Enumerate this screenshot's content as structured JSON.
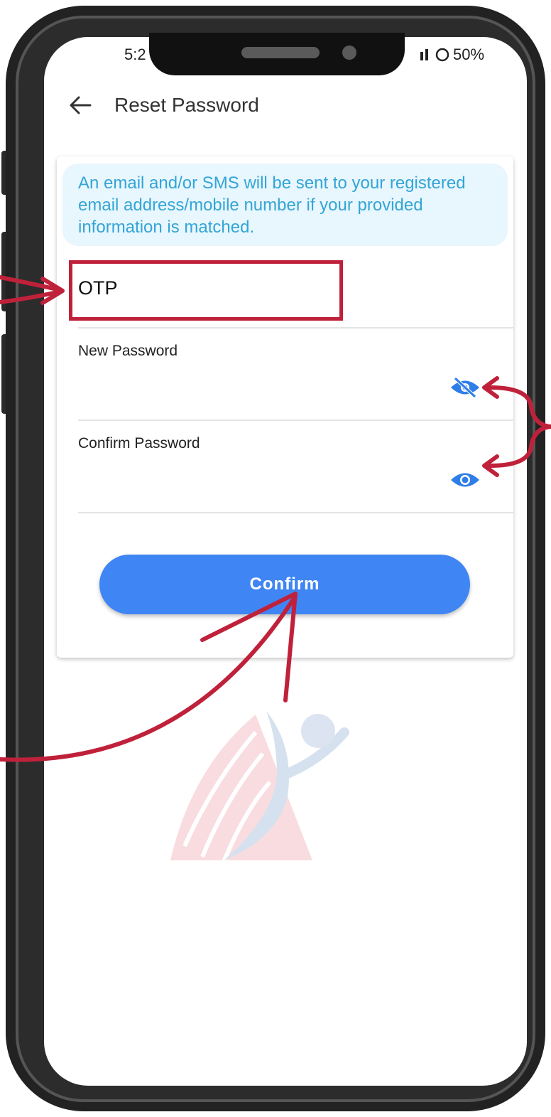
{
  "status_bar": {
    "time": "5:2",
    "battery": "50%"
  },
  "header": {
    "title": "Reset Password",
    "back_icon": "arrow-left-icon"
  },
  "info_message": "An email and/or SMS will be sent to your registered email address/mobile number if your provided information is matched.",
  "form": {
    "otp_label": "OTP",
    "new_password_label": "New Password",
    "confirm_password_label": "Confirm Password",
    "new_password_visibility_icon": "eye-off-icon",
    "confirm_password_visibility_icon": "eye-icon"
  },
  "confirm_button_label": "Confirm",
  "colors": {
    "primary": "#3f85f4",
    "info_text": "#33a5d6",
    "info_bg": "#e8f6fd",
    "annotation": "#c0213a"
  }
}
